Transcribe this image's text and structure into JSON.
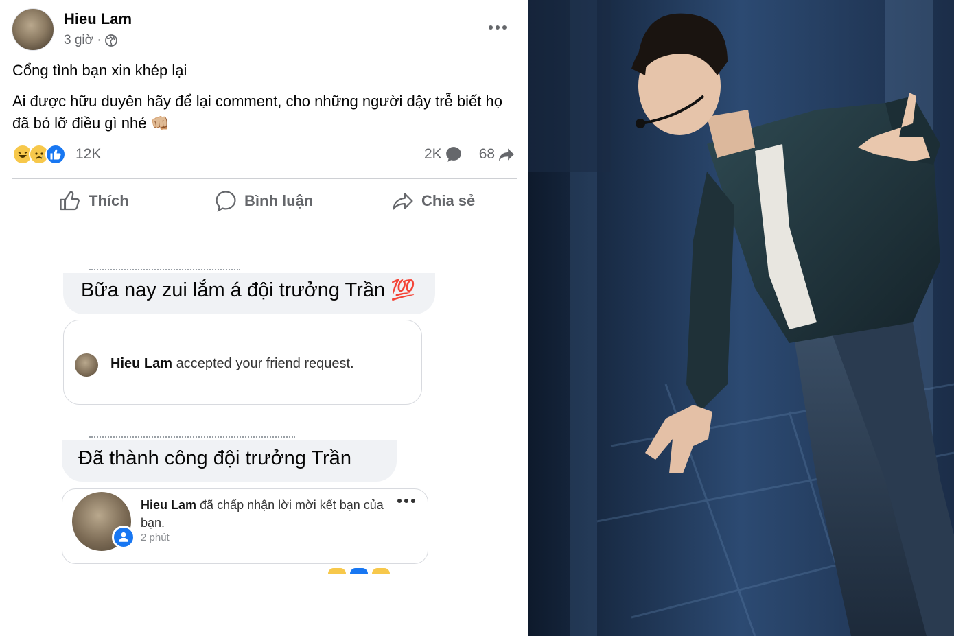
{
  "post": {
    "author": "Hieu Lam",
    "time": "3 giờ ·",
    "headline": "Cổng tình bạn xin khép lại",
    "body": "Ai được hữu duyên hãy để lại comment, cho những người dậy trễ biết họ đã bỏ lỡ điều gì nhé",
    "body_emoji": "👊🏼",
    "reactions": {
      "icons": [
        "haha-icon",
        "sad-icon",
        "like-icon"
      ],
      "count": "12K"
    },
    "comments_count": "2K",
    "shares_count": "68"
  },
  "actions": {
    "like": "Thích",
    "comment": "Bình luận",
    "share": "Chia sẻ"
  },
  "screenshots": {
    "message1": "Bữa nay zui lắm á đội trưởng Trần",
    "message1_emoji": "💯",
    "notif1_name": "Hieu Lam",
    "notif1_text": "accepted your friend request.",
    "message2": "Đã thành công đội trưởng Trần",
    "notif2_name": "Hieu Lam",
    "notif2_text": "đã chấp nhận lời mời kết bạn của bạn.",
    "notif2_time": "2 phút"
  },
  "colors": {
    "accent": "#1877f2",
    "text_secondary": "#65676b",
    "bubble": "#f0f2f5",
    "stage_blue": "#24385a"
  }
}
